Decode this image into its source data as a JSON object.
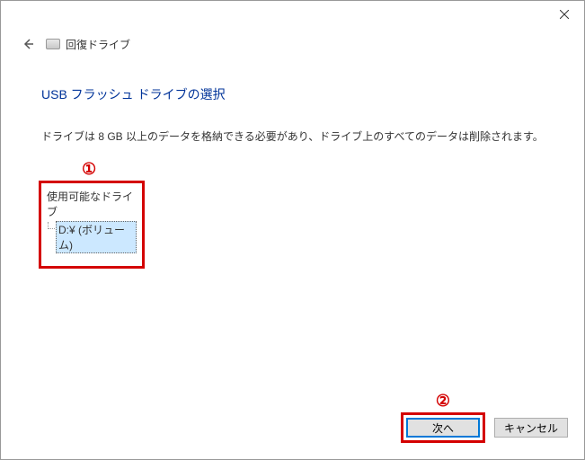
{
  "titlebar": {
    "window_title": "回復ドライブ"
  },
  "content": {
    "page_title": "USB フラッシュ ドライブの選択",
    "description": "ドライブは 8 GB 以上のデータを格納できる必要があり、ドライブ上のすべてのデータは削除されます。",
    "drives_header": "使用可能なドライブ",
    "drive_item": "D:¥ (ボリューム)"
  },
  "annotations": {
    "step1": "①",
    "step2": "②"
  },
  "buttons": {
    "next": "次へ",
    "cancel": "キャンセル"
  }
}
